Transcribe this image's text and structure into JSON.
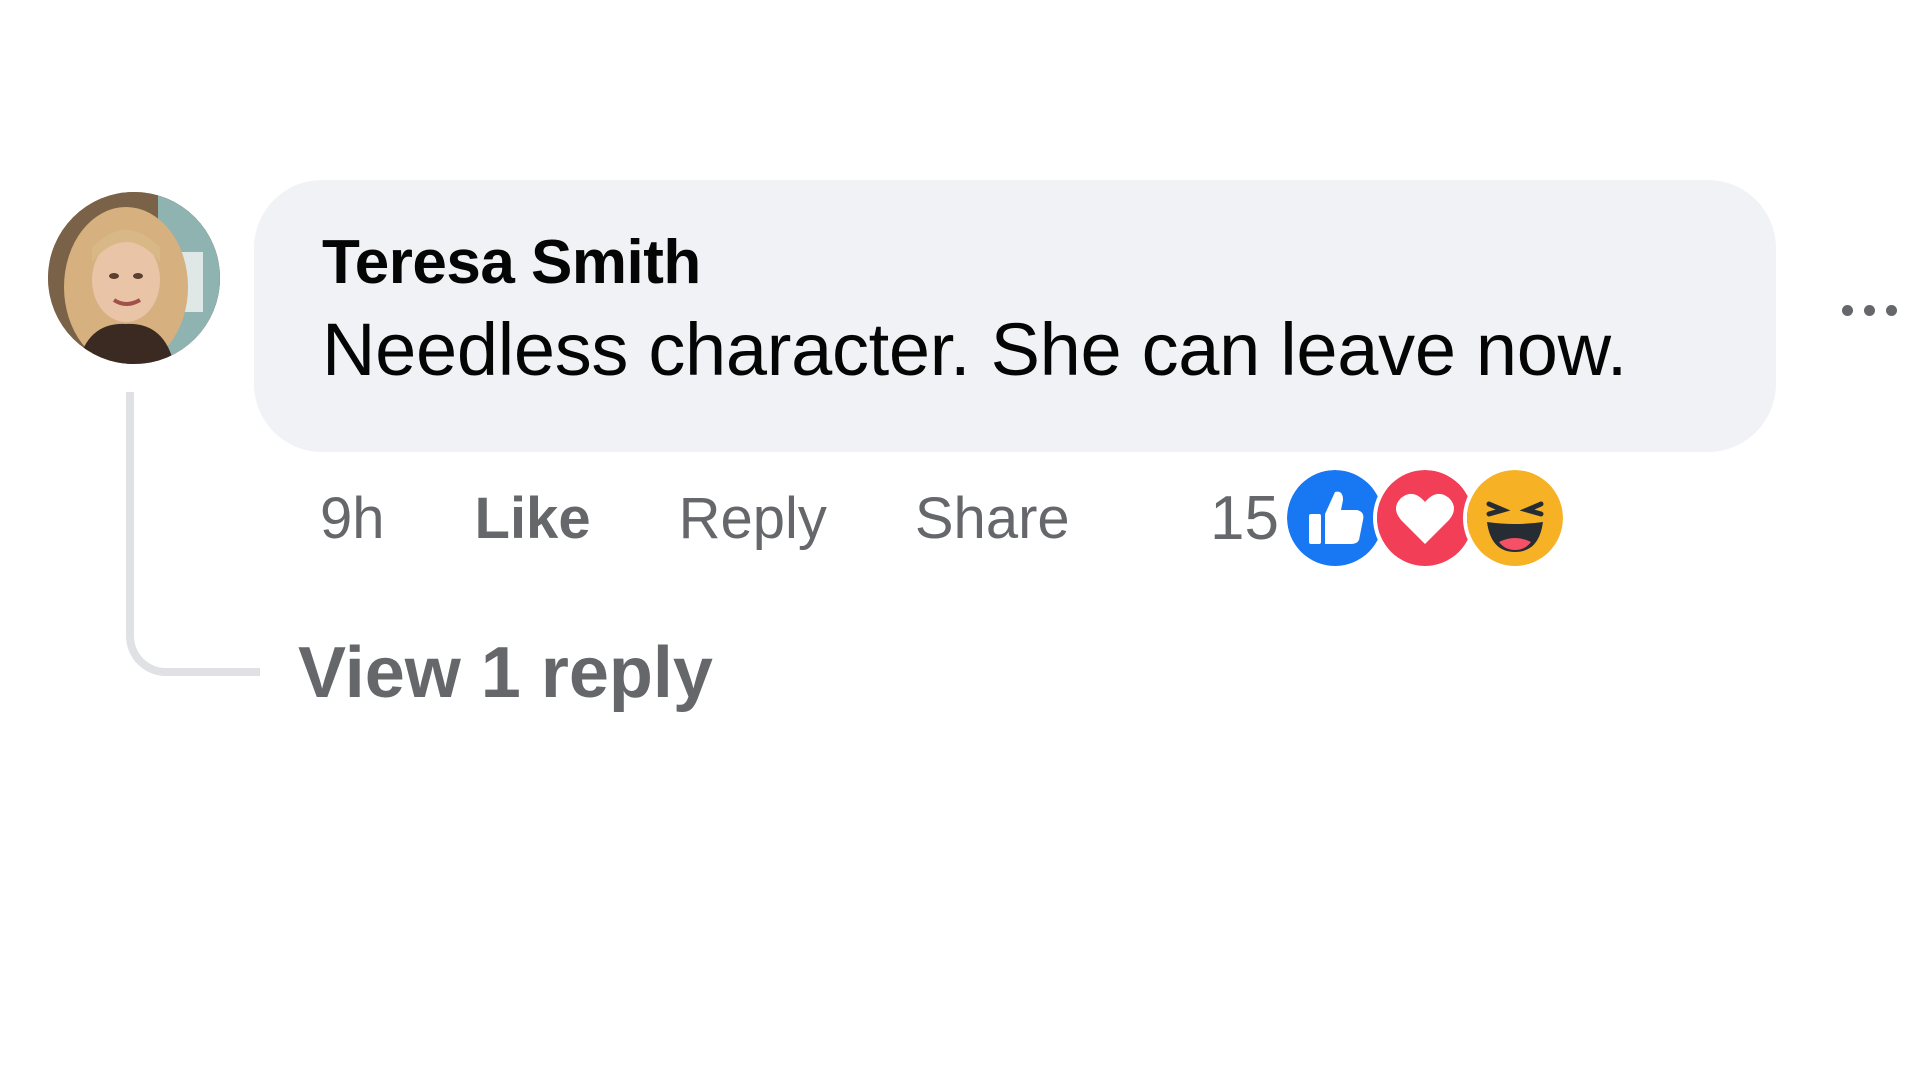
{
  "comment": {
    "author": "Teresa Smith",
    "text": "Needless character. She can leave now.",
    "time": "9h",
    "actions": {
      "like": "Like",
      "reply": "Reply",
      "share": "Share"
    },
    "reaction_count": "15",
    "reactions": [
      "like-icon",
      "love-icon",
      "haha-icon"
    ],
    "view_replies": "View 1 reply"
  },
  "colors": {
    "bubble": "#f0f2f5",
    "secondary_text": "#65676b",
    "like_blue": "#1877f2",
    "love_red": "#f33e58",
    "haha_yellow": "#f7b125"
  }
}
